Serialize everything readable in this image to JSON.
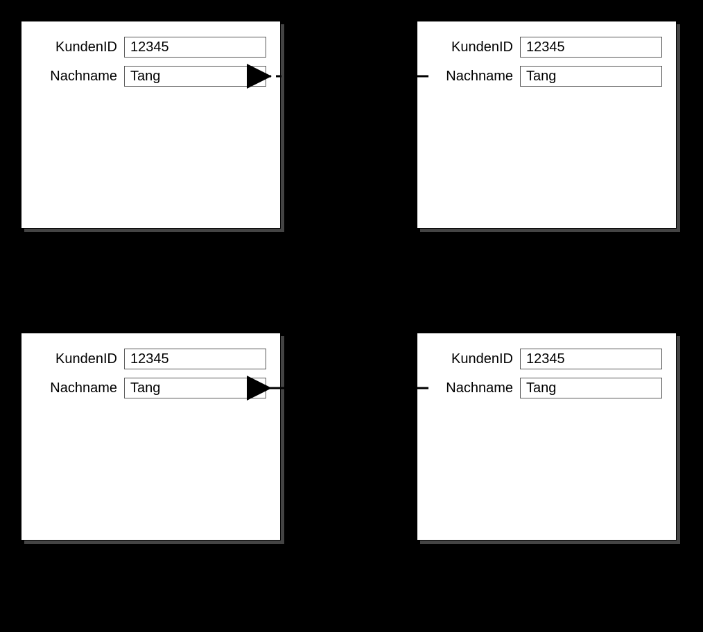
{
  "labels": {
    "kundenid": "KundenID",
    "nachname": "Nachname"
  },
  "forms": {
    "topLeft": {
      "kundenid": "12345",
      "nachname": "Tang"
    },
    "topRight": {
      "kundenid": "12345",
      "nachname": "Tang"
    },
    "bottomLeft": {
      "kundenid": "12345",
      "nachname": "Tang"
    },
    "bottomRight": {
      "kundenid": "12345",
      "nachname": "Tang"
    }
  }
}
